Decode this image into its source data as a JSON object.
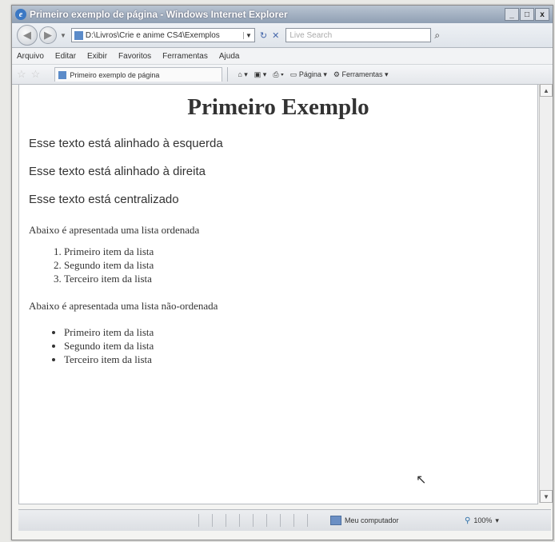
{
  "window": {
    "title": "Primeiro exemplo de página - Windows Internet Explorer",
    "controls": [
      "_",
      "□",
      "x"
    ]
  },
  "address": {
    "url": "D:\\Livros\\Crie e anime CS4\\Exemplos",
    "search_placeholder": "Live Search"
  },
  "menu": [
    "Arquivo",
    "Editar",
    "Exibir",
    "Favoritos",
    "Ferramentas",
    "Ajuda"
  ],
  "tab": {
    "label": "Primeiro exemplo de página"
  },
  "toolbar": {
    "page_label": "Página",
    "tools_label": "Ferramentas"
  },
  "page": {
    "heading": "Primeiro Exemplo",
    "p_left": "Esse texto está alinhado à esquerda",
    "p_right": "Esse texto está alinhado à direita",
    "p_center": "Esse texto está centralizado",
    "ordered_intro": "Abaixo é apresentada uma lista ordenada",
    "ordered_items": [
      "Primeiro item da lista",
      "Segundo item da lista",
      "Terceiro item da lista"
    ],
    "unordered_intro": "Abaixo é apresentada uma lista não-ordenada",
    "unordered_items": [
      "Primeiro item da lista",
      "Segundo item da lista",
      "Terceiro item da lista"
    ]
  },
  "status": {
    "zone": "Meu computador",
    "zoom": "100%"
  }
}
